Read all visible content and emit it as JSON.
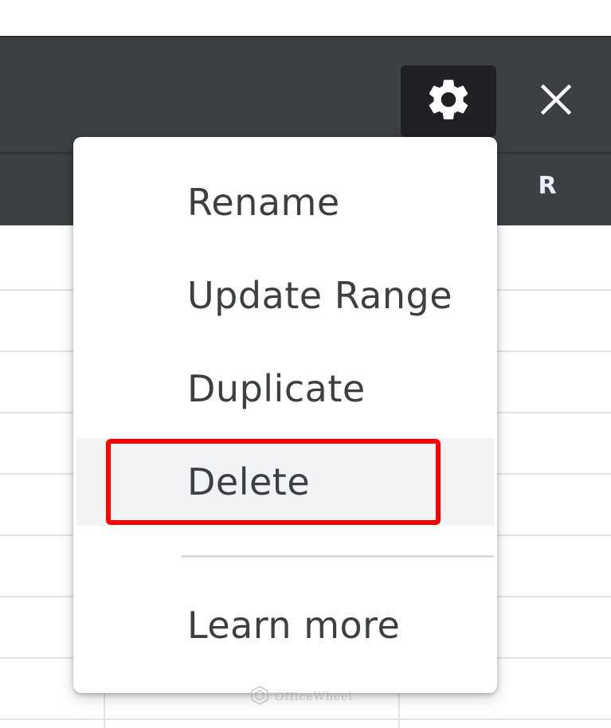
{
  "header": {
    "settings_icon": "gear-icon",
    "close_icon": "close-icon",
    "column_letter": "R"
  },
  "menu": {
    "items": [
      {
        "label": "Rename"
      },
      {
        "label": "Update Range"
      },
      {
        "label": "Duplicate"
      },
      {
        "label": "Delete",
        "highlighted": true
      },
      {
        "label": "Learn more"
      }
    ]
  },
  "watermark": {
    "text": "OfficeWheel"
  },
  "colors": {
    "header_bg": "#3c4043",
    "gear_button_bg": "#202124",
    "menu_bg": "#ffffff",
    "menu_hover_bg": "#f1f3f4",
    "annotation_red": "#ff0000",
    "text": "#3c4043"
  }
}
